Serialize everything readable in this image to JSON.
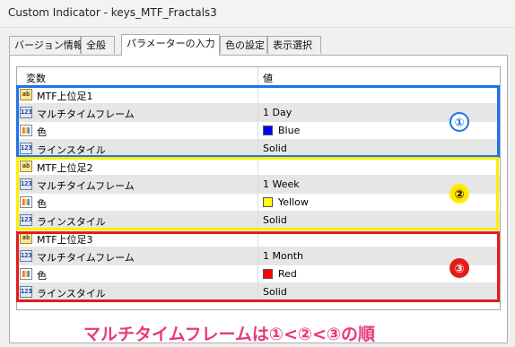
{
  "window": {
    "title": "Custom Indicator - keys_MTF_Fractals3"
  },
  "tabs": [
    {
      "label": "バージョン情報"
    },
    {
      "label": "全般"
    },
    {
      "label": "パラメーターの入力"
    },
    {
      "label": "色の設定"
    },
    {
      "label": "表示選択"
    }
  ],
  "table": {
    "col_variable": "変数",
    "col_value": "値",
    "rows": [
      {
        "name": "MTF上位足1",
        "value": "",
        "icon": "ab"
      },
      {
        "name": "マルチタイムフレーム",
        "value": "1 Day",
        "icon": "123"
      },
      {
        "name": "色",
        "value": "Blue",
        "icon": "color",
        "swatch": "#0000ff"
      },
      {
        "name": "ラインスタイル",
        "value": "Solid",
        "icon": "123"
      },
      {
        "name": "MTF上位足2",
        "value": "",
        "icon": "ab"
      },
      {
        "name": "マルチタイムフレーム",
        "value": "1 Week",
        "icon": "123"
      },
      {
        "name": "色",
        "value": "Yellow",
        "icon": "color",
        "swatch": "#ffff00"
      },
      {
        "name": "ラインスタイル",
        "value": "Solid",
        "icon": "123"
      },
      {
        "name": "MTF上位足3",
        "value": "",
        "icon": "ab"
      },
      {
        "name": "マルチタイムフレーム",
        "value": "1 Month",
        "icon": "123"
      },
      {
        "name": "色",
        "value": "Red",
        "icon": "color",
        "swatch": "#ff0000"
      },
      {
        "name": "ラインスタイル",
        "value": "Solid",
        "icon": "123"
      }
    ]
  },
  "icons": {
    "ab": "ab",
    "num": "123"
  },
  "annotations": {
    "groups": [
      {
        "badge": "①",
        "border_color": "#1e73e8",
        "badge_fill": "#ffffff",
        "badge_text_color": "#1e73e8"
      },
      {
        "badge": "②",
        "border_color": "#ffee00",
        "badge_fill": "#ffe600",
        "badge_text_color": "#000000"
      },
      {
        "badge": "③",
        "border_color": "#e41b1b",
        "badge_fill": "#e41b1b",
        "badge_text_color": "#ffffff"
      }
    ],
    "caption": "マルチタイムフレームは①<②<③の順",
    "caption_color": "#e8387c"
  }
}
